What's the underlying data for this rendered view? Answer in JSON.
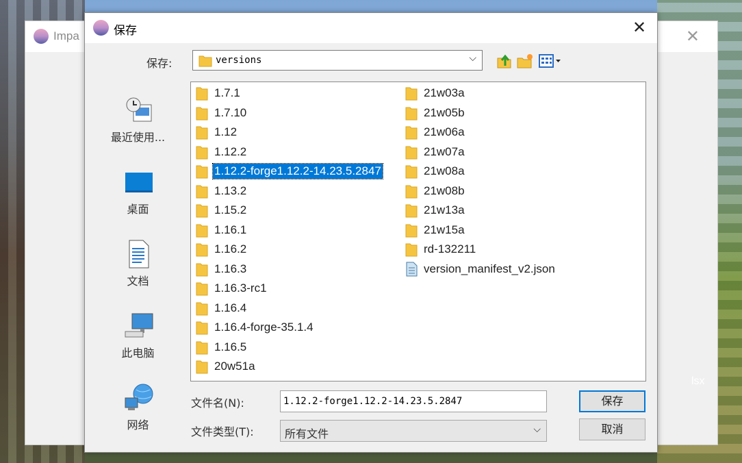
{
  "background_app": {
    "title": "Impa",
    "close": "✕",
    "side_text": "lsx"
  },
  "dialog": {
    "title": "保存",
    "close": "✕",
    "save_in_label": "保存:",
    "current_folder": "versions",
    "places": [
      {
        "label": "最近使用...",
        "icon": "recent-icon"
      },
      {
        "label": "桌面",
        "icon": "desktop-icon"
      },
      {
        "label": "文档",
        "icon": "documents-icon"
      },
      {
        "label": "此电脑",
        "icon": "computer-icon"
      },
      {
        "label": "网络",
        "icon": "network-icon"
      }
    ],
    "files_col1": [
      "1.7.1",
      "1.7.10",
      "1.12",
      "1.12.2",
      "1.12.2-forge1.12.2-14.23.5.2847",
      "1.13.2",
      "1.15.2",
      "1.16.1",
      "1.16.2",
      "1.16.3",
      "1.16.3-rc1",
      "1.16.4",
      "1.16.4-forge-35.1.4",
      "1.16.5",
      "20w51a"
    ],
    "files_col2": [
      "21w03a",
      "21w05b",
      "21w06a",
      "21w07a",
      "21w08a",
      "21w08b",
      "21w13a",
      "21w15a",
      "rd-132211",
      "version_manifest_v2.json"
    ],
    "selected_file": "1.12.2-forge1.12.2-14.23.5.2847",
    "filename_label": "文件名(N):",
    "filename_value": "1.12.2-forge1.12.2-14.23.5.2847",
    "filetype_label": "文件类型(T):",
    "filetype_value": "所有文件",
    "save_button": "保存",
    "cancel_button": "取消"
  },
  "colors": {
    "selection": "#0078d7",
    "folder": "#f5c542",
    "dialog_bg": "#f0f0f0"
  }
}
